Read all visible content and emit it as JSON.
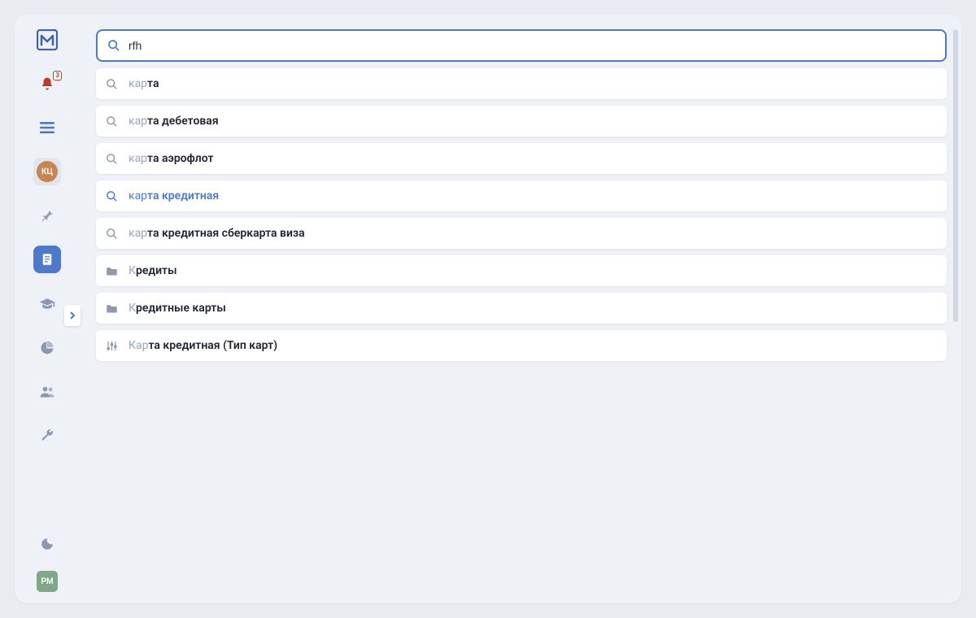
{
  "search": {
    "value": "rfh"
  },
  "notifications": {
    "count": "3"
  },
  "avatars": {
    "kc": {
      "label": "КЦ",
      "bg": "#c98450"
    },
    "pm": {
      "label": "РМ",
      "bg": "#7fa88b"
    }
  },
  "suggestions": [
    {
      "icon": "search",
      "prefix": "кар",
      "rest": "та"
    },
    {
      "icon": "search",
      "prefix": "кар",
      "rest": "та дебетовая"
    },
    {
      "icon": "search",
      "prefix": "кар",
      "rest": "та аэрофлот"
    },
    {
      "icon": "search",
      "prefix": "кар",
      "rest": "та кредитная",
      "highlighted": true
    },
    {
      "icon": "search",
      "prefix": "кар",
      "rest": "та кредитная сберкарта виза"
    },
    {
      "icon": "folder",
      "prefix": "К",
      "rest": "редиты"
    },
    {
      "icon": "folder",
      "prefix": "К",
      "rest": "редитные карты"
    },
    {
      "icon": "sliders",
      "prefix": "Кар",
      "rest": "та кредитная (Тип карт)"
    }
  ]
}
